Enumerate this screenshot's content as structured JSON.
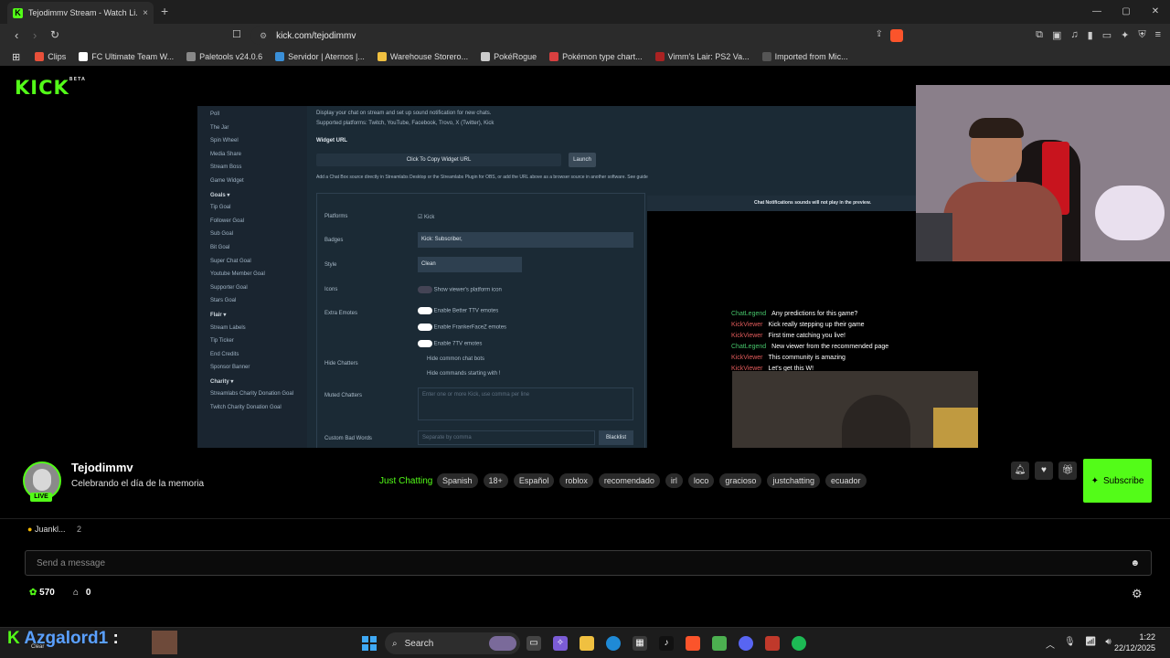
{
  "browser": {
    "tab_title": "Tejodimmv Stream - Watch Li...",
    "tab_close": "×",
    "new_tab": "+",
    "url": "kick.com/tejodimmv",
    "bookmarks": [
      {
        "label": "Clips",
        "color": "#e8503a"
      },
      {
        "label": "FC Ultimate Team W...",
        "color": "#ffffff"
      },
      {
        "label": "Paletools v24.0.6",
        "color": "#888888"
      },
      {
        "label": "Servidor | Aternos |...",
        "color": "#3a8fd8"
      },
      {
        "label": "Warehouse Storero...",
        "color": "#f0c040"
      },
      {
        "label": "PokéRogue",
        "color": "#cccccc"
      },
      {
        "label": "Pokémon type chart...",
        "color": "#d84040"
      },
      {
        "label": "Vimm's Lair: PS2 Va...",
        "color": "#aa2222"
      },
      {
        "label": "Imported from Mic...",
        "color": "#555555"
      }
    ]
  },
  "site": {
    "logo": "KICK",
    "logo_sup": "BETA"
  },
  "video": {
    "sidebar_items": [
      {
        "label": "Poll",
        "hdr": false
      },
      {
        "label": "The Jar",
        "hdr": false
      },
      {
        "label": "Spin Wheel",
        "hdr": false
      },
      {
        "label": "Media Share",
        "hdr": false
      },
      {
        "label": "Stream Boss",
        "hdr": false
      },
      {
        "label": "Game Widget",
        "hdr": false
      },
      {
        "label": "Goals ▾",
        "hdr": true
      },
      {
        "label": "Tip Goal",
        "hdr": false
      },
      {
        "label": "Follower Goal",
        "hdr": false
      },
      {
        "label": "Sub Goal",
        "hdr": false
      },
      {
        "label": "Bit Goal",
        "hdr": false
      },
      {
        "label": "Super Chat Goal",
        "hdr": false
      },
      {
        "label": "Youtube Member Goal",
        "hdr": false
      },
      {
        "label": "Supporter Goal",
        "hdr": false
      },
      {
        "label": "Stars Goal",
        "hdr": false
      },
      {
        "label": "Flair ▾",
        "hdr": true
      },
      {
        "label": "Stream Labels",
        "hdr": false
      },
      {
        "label": "Tip Ticker",
        "hdr": false
      },
      {
        "label": "End Credits",
        "hdr": false
      },
      {
        "label": "Sponsor Banner",
        "hdr": false
      },
      {
        "label": "Charity ▾",
        "hdr": true
      },
      {
        "label": "Streamlabs Charity Donation Goal",
        "hdr": false
      },
      {
        "label": "Twitch Charity Donation Goal",
        "hdr": false
      }
    ],
    "intro": "Display your chat on stream and set up sound notification for new chats.",
    "platforms_note": "Supported platforms: Twitch, YouTube, Facebook, Trovo, X (Twitter), Kick",
    "widget_url_label": "Widget URL",
    "copy_label": "Click To Copy Widget URL",
    "launch_label": "Launch",
    "add_note": "Add a Chat Box source directly in Streamlabs Desktop or the Streamlabs Plugin for OBS, or add the URL above as a browser source in another software. See guide",
    "preview_note": "Chat Notifications sounds will not play in the preview.",
    "rows": {
      "platforms": "Platforms",
      "platforms_val": "Kick",
      "badges": "Badges",
      "badges_val": "Kick: Subscriber,",
      "style": "Style",
      "style_val": "Clean",
      "icons": "Icons",
      "icons_val": "Show viewer's platform icon",
      "extra_emotes": "Extra Emotes",
      "emote1": "Enable Better TTV emotes",
      "emote2": "Enable FrankerFaceZ emotes",
      "emote3": "Enable 7TV emotes",
      "hide_chatters": "Hide Chatters",
      "hide1": "Hide common chat bots",
      "hide2": "Hide commands starting with !",
      "muted": "Muted Chatters",
      "muted_ph": "Enter one or more Kick, use comma per line",
      "bad_words": "Custom Bad Words",
      "bad_ph": "Separate by comma",
      "blacklist": "Blacklist"
    },
    "chat_preview": [
      {
        "user": "ChatLegend",
        "msg": "Any predictions for this game?",
        "color": "#46c46a"
      },
      {
        "user": "KickViewer",
        "msg": "Kick really stepping up their game",
        "color": "#e05a5a"
      },
      {
        "user": "KickViewer",
        "msg": "First time catching you live!",
        "color": "#e05a5a"
      },
      {
        "user": "ChatLegend",
        "msg": "New viewer from the recommended page",
        "color": "#46c46a"
      },
      {
        "user": "KickViewer",
        "msg": "This community is amazing",
        "color": "#e05a5a"
      },
      {
        "user": "KickViewer",
        "msg": "Let's get this W!",
        "color": "#e05a5a"
      }
    ]
  },
  "stream": {
    "streamer": "Tejodimmv",
    "title": "Celebrando el día de la memoria",
    "live": "LIVE",
    "category": "Just Chatting",
    "tags": [
      "Spanish",
      "18+",
      "Español",
      "roblox",
      "recomendado",
      "irl",
      "loco",
      "gracioso",
      "justchatting",
      "ecuador"
    ],
    "subscribe": "Subscribe"
  },
  "chat": {
    "pinned_user": "Juankl...",
    "pinned_count": "2",
    "placeholder": "Send a message",
    "points": "570",
    "drops": "0"
  },
  "taskbar": {
    "overlay_name": "Azgalord1",
    "overlay_colon": ":",
    "overlay_small": "Clear",
    "search": "Search",
    "time": "1:22",
    "date": "22/12/2025"
  }
}
